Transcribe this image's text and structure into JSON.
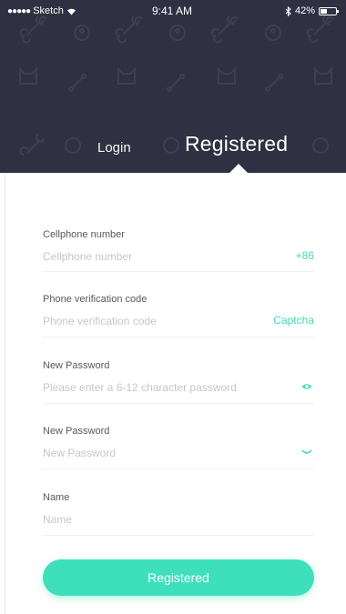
{
  "status_bar": {
    "carrier": "Sketch",
    "signal_dots": "●●●●●",
    "time": "9:41 AM",
    "battery_pct": "42%",
    "battery_level": 0.42
  },
  "tabs": {
    "login_label": "Login",
    "registered_label": "Registered",
    "active": "registered"
  },
  "form": {
    "phone": {
      "label": "Cellphone number",
      "placeholder": "Cellphone number",
      "action_label": "+86"
    },
    "code": {
      "label": "Phone verification code",
      "placeholder": "Phone verification code",
      "action_label": "Captcha"
    },
    "password": {
      "label": "New Password",
      "placeholder": "Please enter a 6-12 character password",
      "icon": "eye-icon"
    },
    "confirm_password": {
      "label": "New Password",
      "placeholder": "New Password",
      "icon": "eye-closed-icon"
    },
    "name": {
      "label": "Name",
      "placeholder": "Name"
    }
  },
  "submit_label": "Registered",
  "colors": {
    "header_bg": "#2f3142",
    "accent": "#3ee0bb",
    "action_text": "#46d8b6",
    "label_text": "#555a60",
    "placeholder_text": "#c3c7cc"
  }
}
